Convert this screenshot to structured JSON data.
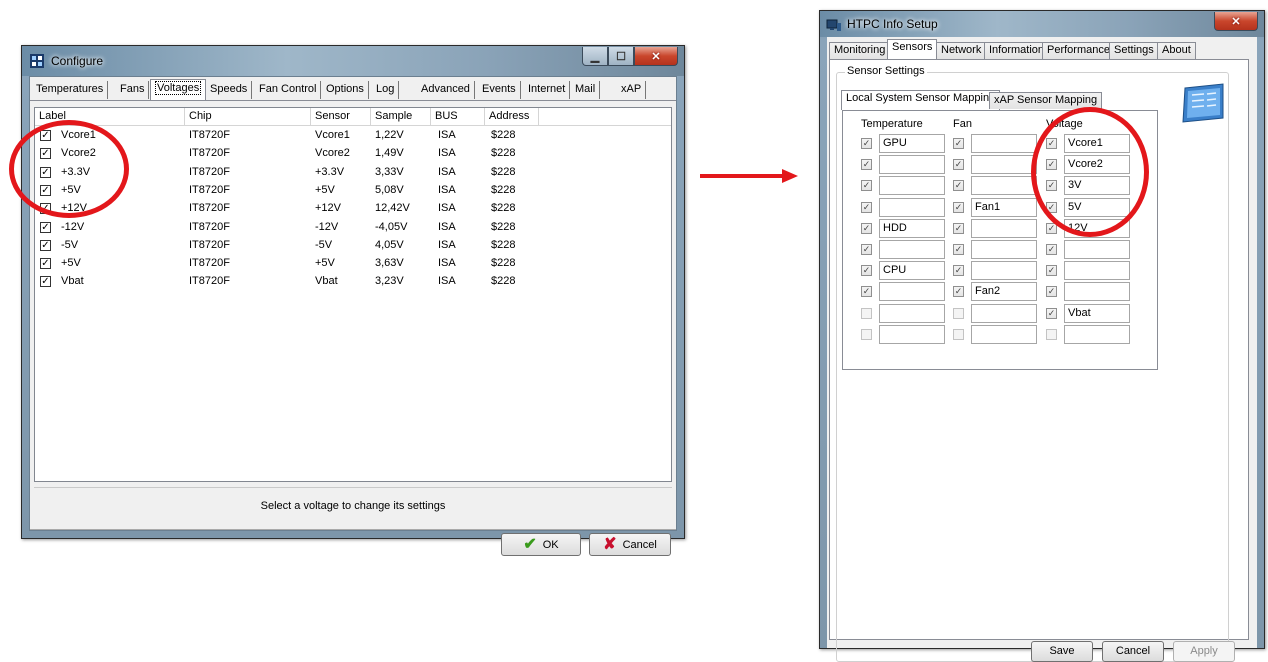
{
  "configure": {
    "title": "Configure",
    "tabs": [
      "Temperatures",
      "Fans",
      "Voltages",
      "Speeds",
      "Fan Control",
      "Options",
      "Log",
      "Advanced",
      "Events",
      "Internet",
      "Mail",
      "xAP"
    ],
    "selected_tab": "Voltages",
    "columns": [
      "Label",
      "Chip",
      "Sensor",
      "Sample",
      "BUS",
      "Address"
    ],
    "rows": [
      {
        "checked": true,
        "label": "Vcore1",
        "chip": "IT8720F",
        "sensor": "Vcore1",
        "sample": "1,22V",
        "bus": "ISA",
        "address": "$228"
      },
      {
        "checked": true,
        "label": "Vcore2",
        "chip": "IT8720F",
        "sensor": "Vcore2",
        "sample": "1,49V",
        "bus": "ISA",
        "address": "$228"
      },
      {
        "checked": true,
        "label": "+3.3V",
        "chip": "IT8720F",
        "sensor": "+3.3V",
        "sample": "3,33V",
        "bus": "ISA",
        "address": "$228"
      },
      {
        "checked": true,
        "label": "+5V",
        "chip": "IT8720F",
        "sensor": "+5V",
        "sample": "5,08V",
        "bus": "ISA",
        "address": "$228"
      },
      {
        "checked": true,
        "label": "+12V",
        "chip": "IT8720F",
        "sensor": "+12V",
        "sample": "12,42V",
        "bus": "ISA",
        "address": "$228"
      },
      {
        "checked": true,
        "label": "-12V",
        "chip": "IT8720F",
        "sensor": "-12V",
        "sample": "-4,05V",
        "bus": "ISA",
        "address": "$228"
      },
      {
        "checked": true,
        "label": "-5V",
        "chip": "IT8720F",
        "sensor": "-5V",
        "sample": "4,05V",
        "bus": "ISA",
        "address": "$228"
      },
      {
        "checked": true,
        "label": "+5V",
        "chip": "IT8720F",
        "sensor": "+5V",
        "sample": "3,63V",
        "bus": "ISA",
        "address": "$228"
      },
      {
        "checked": true,
        "label": "Vbat",
        "chip": "IT8720F",
        "sensor": "Vbat",
        "sample": "3,23V",
        "bus": "ISA",
        "address": "$228"
      }
    ],
    "status_text": "Select a voltage to change its settings",
    "ok_label": "OK",
    "cancel_label": "Cancel"
  },
  "htpc": {
    "title": "HTPC Info Setup",
    "tabs": [
      "Monitoring",
      "Sensors",
      "Network",
      "Information",
      "Performance",
      "Settings",
      "About"
    ],
    "selected_tab": "Sensors",
    "group_title": "Sensor Settings",
    "inner_tabs": [
      "Local System Sensor Mapping",
      "xAP Sensor Mapping"
    ],
    "selected_inner_tab": "Local System Sensor Mapping",
    "col_headers": {
      "temperature": "Temperature",
      "fan": "Fan",
      "voltage": "Voltage"
    },
    "rows": [
      {
        "t_on": true,
        "t_val": "GPU",
        "f_on": true,
        "f_val": "",
        "v_on": true,
        "v_val": "Vcore1"
      },
      {
        "t_on": true,
        "t_val": "",
        "f_on": true,
        "f_val": "",
        "v_on": true,
        "v_val": "Vcore2"
      },
      {
        "t_on": true,
        "t_val": "",
        "f_on": true,
        "f_val": "",
        "v_on": true,
        "v_val": "3V"
      },
      {
        "t_on": true,
        "t_val": "",
        "f_on": true,
        "f_val": "Fan1",
        "v_on": true,
        "v_val": "5V"
      },
      {
        "t_on": true,
        "t_val": "HDD",
        "f_on": true,
        "f_val": "",
        "v_on": true,
        "v_val": "12V"
      },
      {
        "t_on": true,
        "t_val": "",
        "f_on": true,
        "f_val": "",
        "v_on": true,
        "v_val": ""
      },
      {
        "t_on": true,
        "t_val": "CPU",
        "f_on": true,
        "f_val": "",
        "v_on": true,
        "v_val": ""
      },
      {
        "t_on": true,
        "t_val": "",
        "f_on": true,
        "f_val": "Fan2",
        "v_on": true,
        "v_val": ""
      },
      {
        "t_on": false,
        "t_val": "",
        "f_on": false,
        "f_val": "",
        "v_on": true,
        "v_val": "Vbat"
      },
      {
        "t_on": false,
        "t_val": "",
        "f_on": false,
        "f_val": "",
        "v_on": false,
        "v_val": ""
      }
    ],
    "save_label": "Save",
    "cancel_label": "Cancel",
    "apply_label": "Apply"
  },
  "colors": {
    "annotation_red": "#e3171b",
    "ok_green": "#3a9b1c",
    "cancel_red": "#c8102e"
  }
}
